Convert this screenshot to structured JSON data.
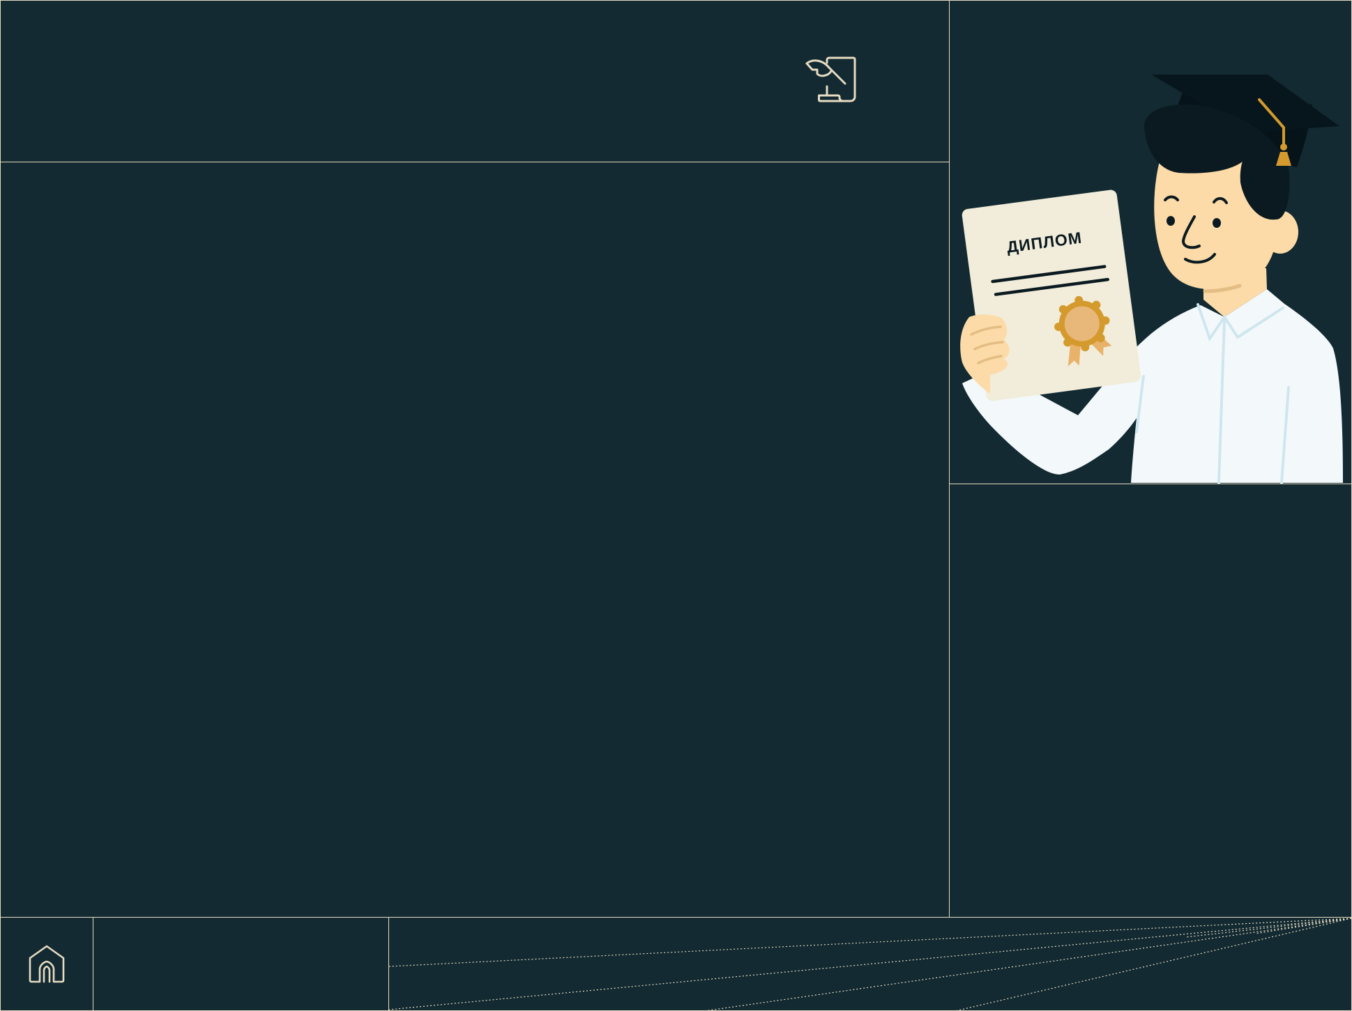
{
  "header": {
    "icon": "diploma-scroll-icon"
  },
  "illustration": {
    "name": "graduate-with-diploma",
    "diploma_label": "ДИПЛОМ"
  },
  "footer": {
    "home_icon": "home-icon"
  },
  "colors": {
    "background": "#132a32",
    "grid_line": "#e7dcc2",
    "accent": "#d49a2e",
    "skin": "#fcdba8",
    "paper": "#f2edda",
    "shirt": "#f3f9fb",
    "dark": "#0b1a20"
  }
}
